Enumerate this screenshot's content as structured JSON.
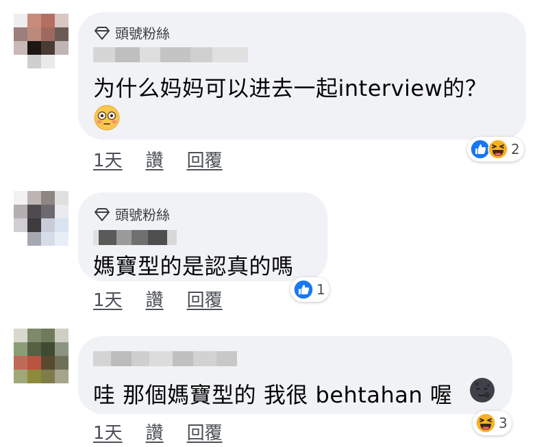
{
  "badge_label": "頭號粉絲",
  "action_labels": {
    "time": "1天",
    "like": "讚",
    "reply": "回覆"
  },
  "colors": {
    "bubble_bg": "#f0f2f5",
    "like_blue": "#1877f2",
    "haha_yellow": "#f7b125",
    "action_text": "#4b4f56"
  },
  "comments": [
    {
      "has_badge": true,
      "author": "",
      "text": "为什么妈妈可以进去一起interview的？",
      "inline_emoji": "flushed-face-emoji",
      "reactions": {
        "icons": [
          "like-icon",
          "haha-icon"
        ],
        "count": "2"
      },
      "avatar_colors": [
        "#eeeeee",
        "#c78b7e",
        "#b56e62",
        "#d8c7c2",
        "#9c7e7a",
        "#bc8a7b",
        "#9e6a60",
        "#6d5a55",
        "#c8b9b6",
        "#1c1614",
        "#4a3b35",
        "#bfb5b3",
        "#ffffff",
        "#cfcfcf",
        "#eaeaea",
        "#ffffff"
      ]
    },
    {
      "has_badge": true,
      "author": "",
      "text": "媽寶型的是認真的嗎",
      "inline_emoji": "",
      "reactions": {
        "icons": [
          "like-icon"
        ],
        "count": "1"
      },
      "avatar_colors": [
        "#f2f2f2",
        "#bdb5b4",
        "#8f8684",
        "#e0e0e0",
        "#b4aeb0",
        "#4f4a4d",
        "#6d6a70",
        "#eaeaf0",
        "#cfcfd2",
        "#3e3a3d",
        "#c9ccd8",
        "#d9e4f2",
        "#ffffff",
        "#a6a8b2",
        "#d7dde8",
        "#e8eef6"
      ]
    },
    {
      "has_badge": false,
      "author": "",
      "text": "哇 那個媽寶型的 我很 behtahan 喔",
      "inline_emoji": "new-moon-face-emoji",
      "reactions": {
        "icons": [
          "haha-icon"
        ],
        "count": "3"
      },
      "avatar_colors": [
        "#d9d8cf",
        "#7c8a6a",
        "#6f7a5d",
        "#cfcfc4",
        "#8a9d76",
        "#556043",
        "#3e4a31",
        "#8b9480",
        "#c06a5a",
        "#b9533f",
        "#5a4a2d",
        "#6e7058",
        "#a0a879",
        "#8e8a3c",
        "#7f7c4a",
        "#a6a48c"
      ]
    }
  ]
}
